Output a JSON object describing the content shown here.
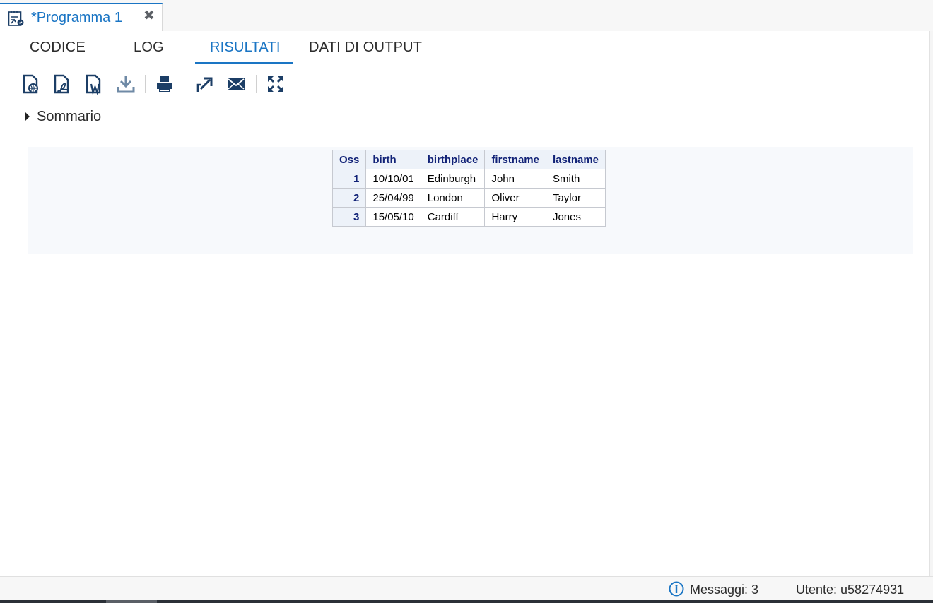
{
  "doc_tab": {
    "title": "*Programma 1",
    "close_glyph": "✖",
    "icon": "program-icon"
  },
  "view_tabs": [
    {
      "label": "CODICE"
    },
    {
      "label": "LOG"
    },
    {
      "label": "RISULTATI"
    },
    {
      "label": "DATI DI OUTPUT"
    }
  ],
  "active_tab": "RISULTATI",
  "toolbar": {
    "icons": [
      "download-html-icon",
      "download-pdf-icon",
      "download-rtf-icon",
      "download-icon",
      "print-icon",
      "open-new-window-icon",
      "email-icon",
      "maximize-icon"
    ]
  },
  "summary": {
    "label": "Sommario",
    "expanded": false
  },
  "results_table": {
    "headers": [
      "Oss",
      "birth",
      "birthplace",
      "firstname",
      "lastname"
    ],
    "rows": [
      [
        "1",
        "10/10/01",
        "Edinburgh",
        "John",
        "Smith"
      ],
      [
        "2",
        "25/04/99",
        "London",
        "Oliver",
        "Taylor"
      ],
      [
        "3",
        "15/05/10",
        "Cardiff",
        "Harry",
        "Jones"
      ]
    ]
  },
  "status": {
    "messages": "Messaggi: 3",
    "user": "Utente: u58274931"
  },
  "colors": {
    "accent": "#1a75c4",
    "icon_dark": "#1c3e66",
    "table_header_text": "#112277",
    "table_header_bg": "#edf2f9"
  }
}
